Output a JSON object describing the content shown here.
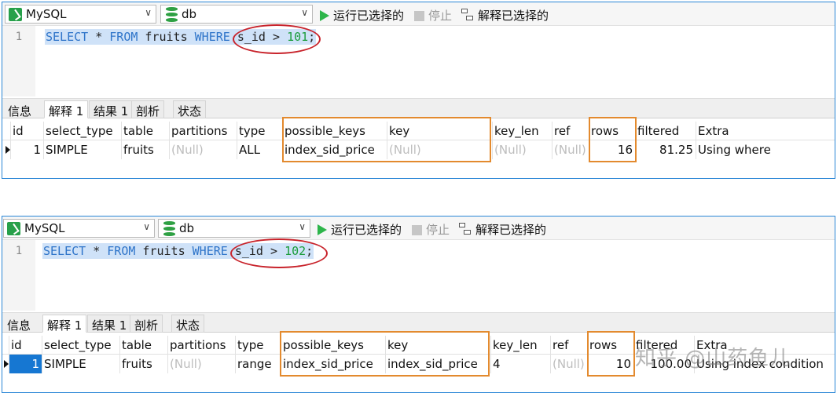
{
  "panels": [
    {
      "toolbar": {
        "connection": "MySQL",
        "database": "db",
        "run_selected": "运行已选择的",
        "stop": "停止",
        "explain_selected": "解释已选择的"
      },
      "editor": {
        "line_number": "1",
        "sql": {
          "select": "SELECT",
          "star": " * ",
          "from": "FROM",
          "table": " fruits ",
          "where": "WHERE",
          "col": " s_id > ",
          "value": "101",
          "end": ";"
        }
      },
      "tabs": [
        "信息",
        "解释 1",
        "结果 1",
        "剖析",
        "状态"
      ],
      "columns": [
        "id",
        "select_type",
        "table",
        "partitions",
        "type",
        "possible_keys",
        "key",
        "key_len",
        "ref",
        "rows",
        "filtered",
        "Extra"
      ],
      "row": [
        "1",
        "SIMPLE",
        "fruits",
        "(Null)",
        "ALL",
        "index_sid_price",
        "(Null)",
        "(Null)",
        "(Null)",
        "16",
        "81.25",
        "Using where"
      ]
    },
    {
      "toolbar": {
        "connection": "MySQL",
        "database": "db",
        "run_selected": "运行已选择的",
        "stop": "停止",
        "explain_selected": "解释已选择的"
      },
      "editor": {
        "line_number": "1",
        "sql": {
          "select": "SELECT",
          "star": " * ",
          "from": "FROM",
          "table": " fruits ",
          "where": "WHERE",
          "col": " s_id > ",
          "value": "102",
          "end": ";"
        }
      },
      "tabs": [
        "信息",
        "解释 1",
        "结果 1",
        "剖析",
        "状态"
      ],
      "columns": [
        "id",
        "select_type",
        "table",
        "partitions",
        "type",
        "possible_keys",
        "key",
        "key_len",
        "ref",
        "rows",
        "filtered",
        "Extra"
      ],
      "row": [
        "1",
        "SIMPLE",
        "fruits",
        "(Null)",
        "range",
        "index_sid_price",
        "index_sid_price",
        "4",
        "(Null)",
        "10",
        "100.00",
        "Using index condition"
      ]
    }
  ],
  "watermark": "知乎 @山药鱼儿",
  "colors": {
    "accent": "#2a86d6",
    "highlight_box": "#e38a2e",
    "ellipse": "#c8232b",
    "keyword": "#2e74c9",
    "number": "#1a9c3a",
    "null_text": "#bdbdbd"
  }
}
